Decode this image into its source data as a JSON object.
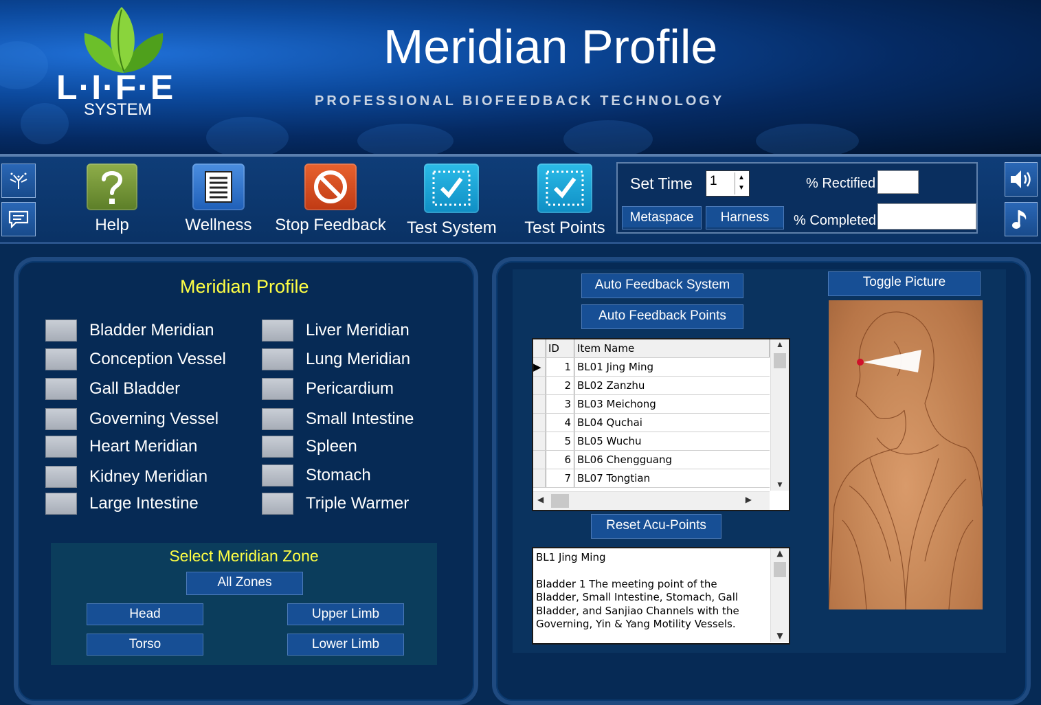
{
  "header": {
    "logo_text": "L·I·F·E",
    "logo_sub": "SYSTEM",
    "title": "Meridian Profile",
    "tagline": "PROFESSIONAL BIOFEEDBACK TECHNOLOGY"
  },
  "toolbar": {
    "help": "Help",
    "wellness": "Wellness",
    "stop_feedback": "Stop Feedback",
    "test_system": "Test System",
    "test_points": "Test Points",
    "set_time_label": "Set Time",
    "set_time_value": "1",
    "metaspace": "Metaspace",
    "harness": "Harness",
    "pct_rectified": "% Rectified",
    "pct_completed": "% Completed"
  },
  "left_panel": {
    "title": "Meridian Profile",
    "meridians_col1": [
      "Bladder Meridian",
      "Conception Vessel",
      "Gall Bladder",
      "Governing Vessel",
      "Heart Meridian",
      "Kidney Meridian",
      "Large Intestine"
    ],
    "meridians_col2": [
      "Liver Meridian",
      "Lung Meridian",
      "Pericardium",
      "Small Intestine",
      "Spleen",
      "Stomach",
      "Triple Warmer"
    ],
    "zone_title": "Select Meridian Zone",
    "zones": {
      "all": "All Zones",
      "head": "Head",
      "upper_limb": "Upper Limb",
      "torso": "Torso",
      "lower_limb": "Lower Limb"
    }
  },
  "right_panel": {
    "auto_feedback_system": "Auto Feedback System",
    "auto_feedback_points": "Auto Feedback Points",
    "toggle_picture": "Toggle Picture",
    "reset_acu_points": "Reset Acu-Points",
    "grid": {
      "col_id": "ID",
      "col_name": "Item Name",
      "rows": [
        {
          "id": "1",
          "name": "BL01 Jing Ming"
        },
        {
          "id": "2",
          "name": "BL02 Zanzhu"
        },
        {
          "id": "3",
          "name": "BL03 Meichong"
        },
        {
          "id": "4",
          "name": "BL04 Quchai"
        },
        {
          "id": "5",
          "name": "BL05 Wuchu"
        },
        {
          "id": "6",
          "name": "BL06 Chengguang"
        },
        {
          "id": "7",
          "name": "BL07 Tongtian"
        }
      ]
    },
    "description": {
      "heading": "BL1 Jing Ming",
      "body": "Bladder 1 The meeting point of the Bladder, Small Intestine, Stomach, Gall Bladder, and Sanjiao Channels with the Governing, Yin & Yang Motility Vessels."
    }
  },
  "colors": {
    "accent_yellow": "#ffff44",
    "button_blue": "#174f95",
    "help_green": "#7a9a3c",
    "stop_red": "#d64a1e",
    "test_cyan": "#1aa7d8"
  }
}
